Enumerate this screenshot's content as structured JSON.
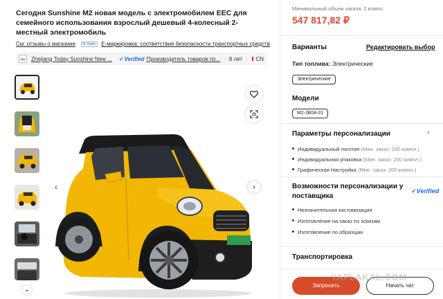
{
  "product": {
    "title": "Сегодня Sunshine M2 новая модель с электромобилем EEC для семейного использования взрослый дешевый 4-колесный 2-местный электромобиль",
    "reviews_link": "См. отзывы о магазине",
    "emark_badge": "E-mark",
    "emark_text": "E-маркировка: соответствие безопасности транспортных средств"
  },
  "supplier": {
    "name": "Zhejiang Today Sunshine New ...",
    "verified": "Verified",
    "products_text": "Производитель товаров по...",
    "years": "8 лет",
    "country": "CN"
  },
  "gallery": {
    "thumbnails": [
      "thumb-front",
      "thumb-rear-hatch",
      "thumb-side",
      "thumb-front-2",
      "thumb-interior",
      "thumb-interior-2"
    ]
  },
  "pricing": {
    "min_order": "Минимальный объем заказа: 2 компл.",
    "price": "547 817,82 ₽"
  },
  "variants": {
    "heading": "Варианты",
    "edit_link": "Редактировать выбор",
    "fuel_label": "Тип топлива:",
    "fuel_value": "Электрические",
    "fuel_chip": "Электрические",
    "models_heading": "Модели",
    "model_chip": "M2-JB04-01"
  },
  "customization": {
    "heading": "Параметры персонализации",
    "items": [
      {
        "name": "Индивидуальный логотип",
        "moq": "(Мин. заказ: 200 компл.)"
      },
      {
        "name": "Индивидуальная упаковка",
        "moq": "(Мин. заказ: 200 компл.)"
      },
      {
        "name": "Графическая Настройка",
        "moq": "(Мин. заказ: 200 компл.)"
      }
    ]
  },
  "supplier_capabilities": {
    "heading": "Возможности персонализации у поставщика",
    "verified": "Verified",
    "items": [
      "Незначительная кастомизация",
      "Изготовление на заказ по эскизам",
      "Изготовление по образцам"
    ]
  },
  "transport": {
    "heading": "Транспортировка"
  },
  "actions": {
    "request": "Запросить",
    "chat": "Начать чат"
  },
  "watermark": "YAPLAKAL.COM",
  "colors": {
    "price": "#e0472f",
    "primary_button": "#d64b2a",
    "verified": "#1d6fd8",
    "car_body": "#f2b705"
  }
}
